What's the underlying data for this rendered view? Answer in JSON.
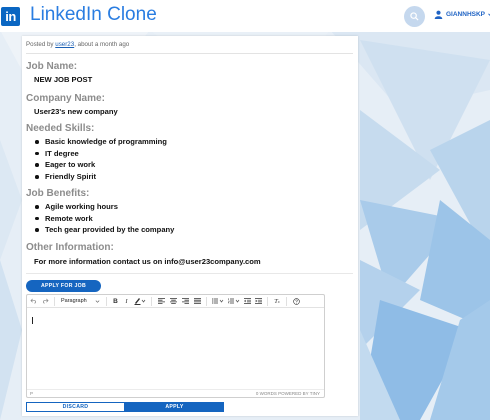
{
  "header": {
    "logo_text": "in",
    "app_title": "LinkedIn Clone",
    "username": "GIANNHSKP",
    "user_dropdown_icon": "chevron-down-icon",
    "brand_color": "#0a66c2"
  },
  "post": {
    "posted_by_prefix": "Posted by",
    "author": "user23",
    "posted_time": ", about a month ago"
  },
  "job": {
    "name_title": "Job Name:",
    "name_value": "NEW JOB POST",
    "company_title": "Company Name:",
    "company_value": "User23's new company",
    "skills_title": "Needed Skills:",
    "skills": [
      "Basic knowledge of programming",
      "IT degree",
      "Eager to work",
      "Friendly Spirit"
    ],
    "benefits_title": "Job Benefits:",
    "benefits": [
      "Agile working hours",
      "Remote work",
      "Tech gear provided by the company"
    ],
    "other_title": "Other Information:",
    "other_value": "For more information contact us on info@user23company.com"
  },
  "actions": {
    "apply_for_job": "APPLY FOR JOB",
    "discard": "DISCARD",
    "apply": "APPLY"
  },
  "editor": {
    "block_format": "Paragraph",
    "status_path": "P",
    "status_words": "0 WORDS  POWERED BY TINY"
  }
}
